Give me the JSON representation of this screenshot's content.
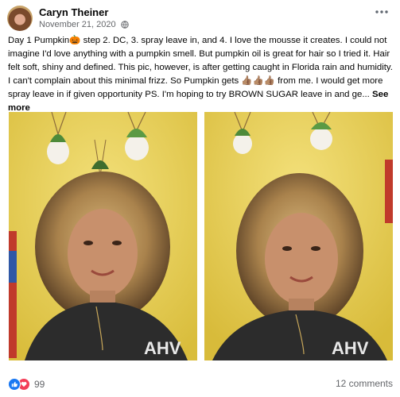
{
  "post": {
    "author": "Caryn Theiner",
    "date": "November 21, 2020",
    "privacy_icon": "globe-icon",
    "text_parts": {
      "part1": "Day 1 Pumpkin",
      "part2": " step 2. DC, 3. spray leave in, and 4.  I love the mousse it creates. I could not imagine I'd love anything with a pumpkin smell.  But pumpkin oil is great for hair so I tried it. Hair felt soft, shiny and defined. This pic,  however, is after getting caught in Florida rain and humidity. I can't complain about this minimal frizz. So Pumpkin gets ",
      "part3": " from me. I would get more spray leave in if given opportunity PS. I'm hoping to try BROWN SUGAR leave in and ge... ",
      "emoji_pumpkin": "🎃",
      "emoji_thumbs": "👍🏽👍🏽👍🏽"
    },
    "see_more_label": "See more"
  },
  "photos": [
    {
      "alt": "Selfie of woman with curly hair in yellow room"
    },
    {
      "alt": "Selfie of woman with curly hair in yellow room, closer"
    }
  ],
  "footer": {
    "reaction_count": "99",
    "comments_label": "12 comments"
  },
  "colors": {
    "like_blue": "#1877f2",
    "love_red": "#f33e58",
    "wall_yellow": "#e7cf57"
  }
}
